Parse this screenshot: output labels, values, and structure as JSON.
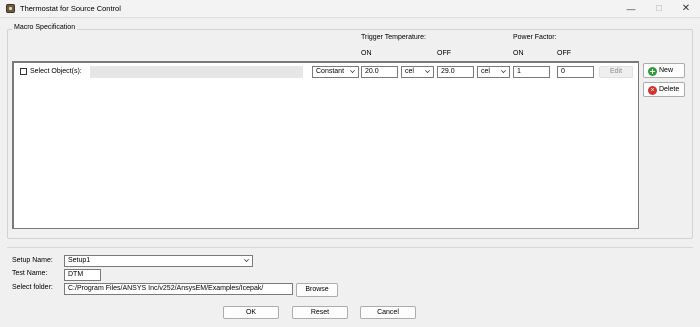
{
  "window": {
    "title": "Thermostat for Source Control",
    "minimize_glyph": "—",
    "maximize_glyph": "☐",
    "close_glyph": "✕",
    "app_icon": "thermostat-app-icon"
  },
  "macro_spec": {
    "legend": "Macro Specification",
    "trigger_temperature_label": "Trigger Temperature:",
    "power_factor_label": "Power Factor:",
    "on_label": "ON",
    "off_label": "OFF",
    "row": {
      "select_objects_label": "Select Object(s):",
      "select_objects_checked": false,
      "object_value": "",
      "mode": "Constant",
      "trigger_on_value": "20.0",
      "trigger_on_unit": "cel",
      "trigger_off_value": "29.0",
      "trigger_off_unit": "cel",
      "power_on_value": "1",
      "power_off_value": "0",
      "edit_label": "Edit"
    },
    "new_label": "New",
    "delete_label": "Delete"
  },
  "setup": {
    "setup_name_label": "Setup Name:",
    "setup_name_value": "Setup1",
    "test_name_label": "Test Name:",
    "test_name_value": "DTM",
    "select_folder_label": "Select folder:",
    "folder_path": "C:/Program Files/ANSYS Inc/v252/AnsysEM/Examples/Icepak/",
    "browse_label": "Browse"
  },
  "footer": {
    "ok_label": "OK",
    "reset_label": "Reset",
    "cancel_label": "Cancel"
  },
  "colors": {
    "new_icon": "#2d9d3a",
    "delete_icon": "#d0342c"
  }
}
